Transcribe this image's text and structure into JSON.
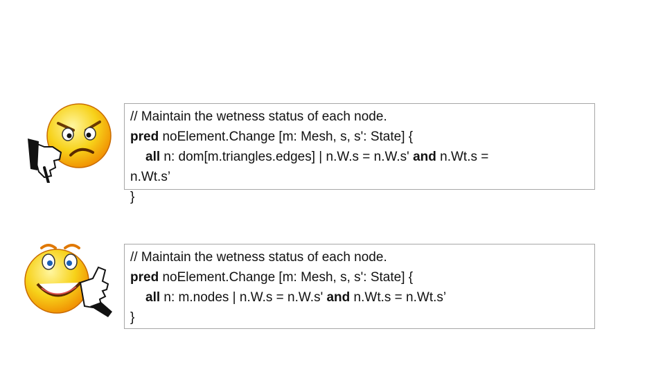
{
  "colors": {
    "box_border": "#a6a6a6",
    "emoji_yellow": "#f7d21a",
    "emoji_orange": "#f08a00",
    "text": "#111111"
  },
  "icons": {
    "bad_example": "angry-thumbs-down-emoji-icon",
    "good_example": "happy-thumbs-up-emoji-icon"
  },
  "box1": {
    "comment": "// Maintain the wetness status of each node.",
    "pred_kw": "pred",
    "pred_sig": " noElement.Change [m: Mesh, s, s': State] {",
    "all_kw": "all",
    "body_a": " n: dom[m.triangles.edges] | n.W.s = n.W.s' ",
    "and_kw": "and",
    "body_b": " n.Wt.s =",
    "wrap": "n.Wt.s’",
    "close": "}"
  },
  "box2": {
    "comment": "// Maintain the wetness status of each node.",
    "pred_kw": "pred",
    "pred_sig": " noElement.Change [m: Mesh, s, s': State] {",
    "all_kw": "all",
    "body_a": " n: m.nodes | n.W.s = n.W.s' ",
    "and_kw": "and",
    "body_b": " n.Wt.s = n.Wt.s’",
    "close": "}"
  }
}
